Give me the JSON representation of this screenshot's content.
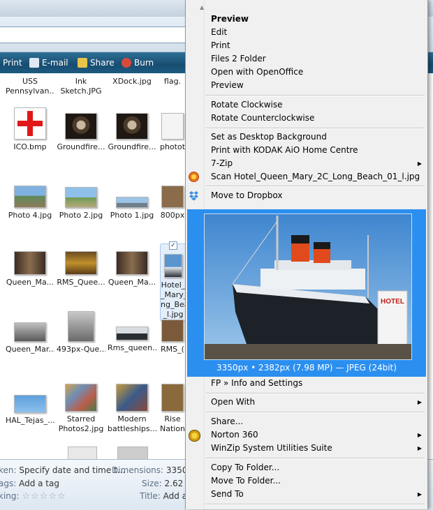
{
  "toolbar": {
    "print": "Print",
    "email": "E-mail",
    "share": "Share",
    "burn": "Burn"
  },
  "files": [
    {
      "label": "USS Pennsylvan...",
      "thumb": "none"
    },
    {
      "label": "Ink Sketch.JPG",
      "thumb": "none"
    },
    {
      "label": "XDock.jpg",
      "thumb": "none"
    },
    {
      "label": "flag.",
      "thumb": "none"
    },
    {
      "label": "ICO.bmp",
      "thumb": "cross"
    },
    {
      "label": "Groundfire...",
      "thumb": "dark"
    },
    {
      "label": "Groundfire...",
      "thumb": "dark"
    },
    {
      "label": "photot",
      "thumb": "light"
    },
    {
      "label": "Photo 4.jpg",
      "thumb": "sky"
    },
    {
      "label": "Photo 2.jpg",
      "thumb": "sky"
    },
    {
      "label": "Photo 1.jpg",
      "thumb": "sky"
    },
    {
      "label": "800px",
      "thumb": "brown"
    },
    {
      "label": "Queen_Ma...",
      "thumb": "brown"
    },
    {
      "label": "RMS_Quee...",
      "thumb": "brown"
    },
    {
      "label": "Queen_Ma...",
      "thumb": "brown"
    },
    {
      "label": "Hotel_Queen_Mary_2C_Long_Beach_01_l.jpg",
      "thumb": "ship"
    },
    {
      "label": "Queen_Mar...",
      "thumb": "gray"
    },
    {
      "label": "493px-Que...",
      "thumb": "gray"
    },
    {
      "label": "Rms_queen...",
      "thumb": "ship"
    },
    {
      "label": "RMS_(",
      "thumb": "brown"
    },
    {
      "label": "HAL_Tejas_...",
      "thumb": "sky"
    },
    {
      "label": "Starred Photos2.jpg",
      "thumb": "collage"
    },
    {
      "label": "Modern battleships....",
      "thumb": "collage"
    },
    {
      "label": "Rise Nation",
      "thumb": "brown"
    }
  ],
  "selected_file_lines": [
    "Hotel_",
    "_Mary_",
    "ng_Bea",
    "_l.jpg"
  ],
  "details": {
    "taken_key": "ken:",
    "taken_value": "Specify date and time t...",
    "tags_key": "ags:",
    "tags_value": "Add a tag",
    "rating_key": "king:",
    "rating_stars": "☆☆☆☆☆",
    "dimensions_key": "Dimensions:",
    "dimensions_value": "3350 x",
    "size_key": "Size:",
    "size_value": "2.62 M",
    "title_key": "Title:",
    "title_value": "Add a"
  },
  "menu": {
    "group1": [
      "Preview",
      "Edit",
      "Print",
      "Files 2 Folder",
      "Open with OpenOffice",
      "Preview"
    ],
    "group2": [
      "Rotate Clockwise",
      "Rotate Counterclockwise"
    ],
    "group3": [
      "Set as Desktop Background",
      "Print with KODAK AiO Home Centre",
      "7-Zip",
      "Scan Hotel_Queen_Mary_2C_Long_Beach_01_l.jpg"
    ],
    "group4": [
      "Move to Dropbox"
    ],
    "preview_info": "3350px • 2382px (7.98 MP) — JPEG (24bit)",
    "group5": [
      "FP » Info and Settings"
    ],
    "group6": [
      "Open With"
    ],
    "group7": [
      "Share...",
      "Norton 360",
      "WinZip System Utilities Suite"
    ],
    "group8": [
      "Copy To Folder...",
      "Move To Folder...",
      "Send To"
    ],
    "photo_sign": "HOTEL"
  },
  "colors": {
    "menu_bg": "#f0f0f0",
    "preview_bg": "#2b8ff0",
    "toolbar_bg": "#1c5a82"
  }
}
